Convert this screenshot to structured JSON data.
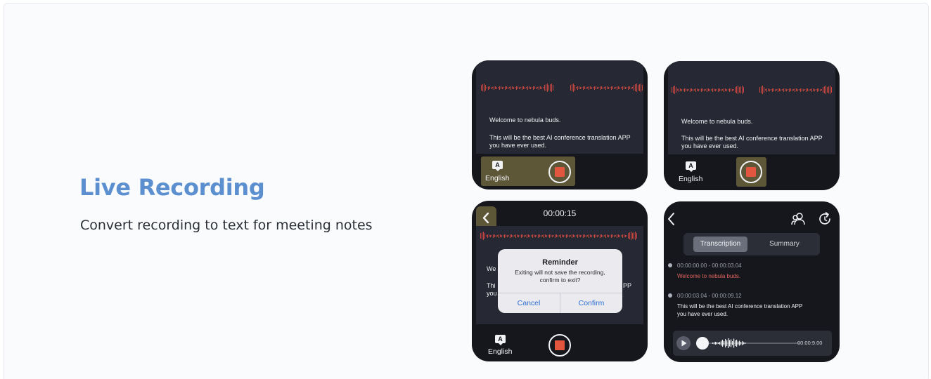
{
  "feature": {
    "title": "Live Recording",
    "subtitle": "Convert recording to text for meeting notes"
  },
  "colors": {
    "accent": "#5b8fcf",
    "watch_bg": "#16171d",
    "highlight": "#5d5637",
    "record_red": "#e2553f",
    "waveform_red": "#c9453f",
    "dialog_blue": "#2f6fd1"
  },
  "screens": {
    "recording": {
      "line1": "Welcome to nebula buds.",
      "line2": "This will be the best AI conference translation APP",
      "line3": "you have ever used.",
      "language": "English",
      "language_icon": "A"
    },
    "exit_dialog": {
      "timer": "00:00:15",
      "obscured_text_1": "We",
      "obscured_text_2": "Thi",
      "obscured_text_3": "you",
      "obscured_text_4": "PP",
      "language": "English",
      "language_icon": "A",
      "dialog": {
        "title": "Reminder",
        "message_line1": "Exiting will not save the recording,",
        "message_line2": "confirm to exit?",
        "cancel": "Cancel",
        "confirm": "Confirm"
      }
    },
    "transcript": {
      "tabs": [
        "Transcription",
        "Summary"
      ],
      "active_tab": "Transcription",
      "entries": [
        {
          "time": "00:00:00.00 - 00:00:03.04",
          "text": "Welcome to nebula buds.",
          "color": "#e0645a"
        },
        {
          "time": "00:00:03.04 - 00:00:09.12",
          "text": "This will be the best AI conference translation APP",
          "text2": "you have ever used.",
          "color": "#f1f2f4"
        }
      ],
      "player_time": "00:00:9.00",
      "icons": [
        "back-icon",
        "speakers-icon",
        "regenerate-icon",
        "play-icon"
      ]
    }
  }
}
